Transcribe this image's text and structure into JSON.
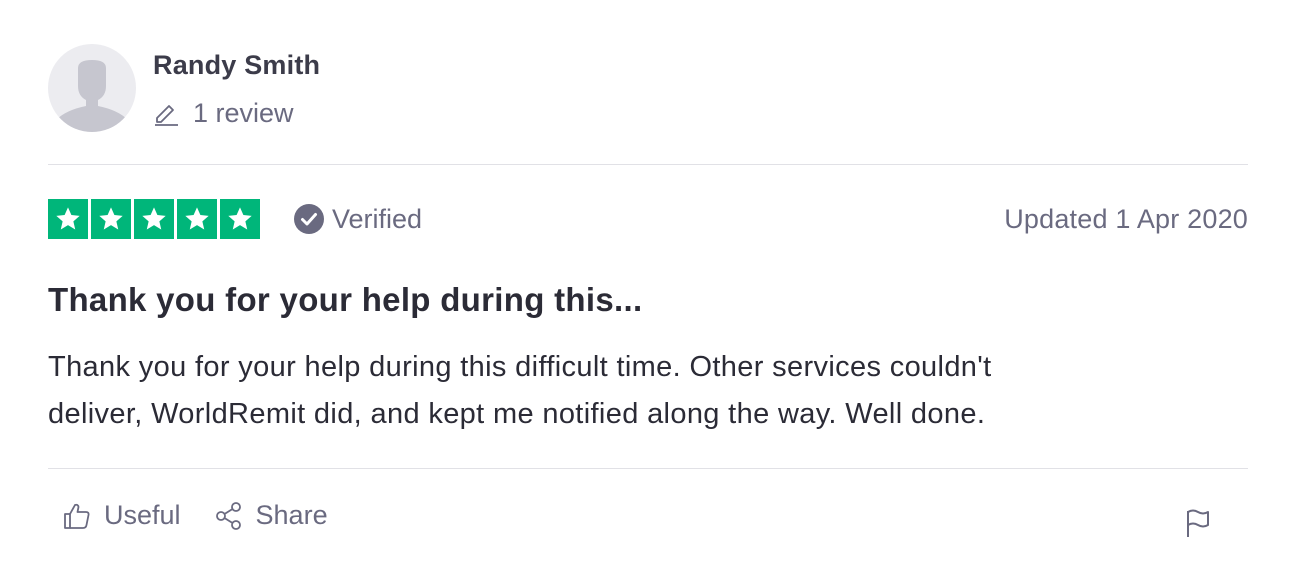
{
  "consumer": {
    "name": "Randy Smith",
    "review_count": "1 review",
    "avatar_icon": "person-silhouette-icon"
  },
  "rating": {
    "stars": 5,
    "max_stars": 5,
    "star_color": "#00b67a",
    "verified_label": "Verified",
    "date_label": "Updated 1 Apr 2020"
  },
  "review": {
    "title": "Thank you for your help during this...",
    "text_line1": "Thank you for your help during this difficult time. Other services couldn't",
    "text_line2": "deliver, WorldRemit did, and kept me notified along the way. Well done."
  },
  "actions": {
    "useful_label": "Useful",
    "share_label": "Share",
    "useful_icon": "thumbs-up-icon",
    "share_icon": "share-icon",
    "flag_icon": "flag-icon"
  },
  "colors": {
    "text_primary": "#2b2b36",
    "text_muted": "#6a6a80",
    "divider": "#e1e1e6",
    "verified_badge": "#6a6a80"
  }
}
